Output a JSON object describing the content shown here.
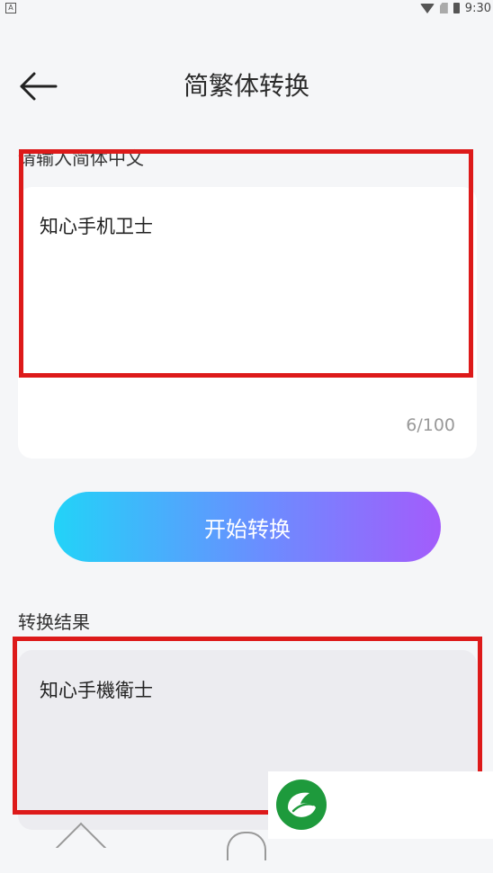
{
  "status_bar": {
    "left_indicator": "A",
    "time": "9:30",
    "icons": [
      "wifi-icon",
      "sim-icon",
      "battery-icon"
    ]
  },
  "header": {
    "title": "简繁体转换",
    "back_icon": "arrow-left-icon"
  },
  "input": {
    "label": "请输入简体中文",
    "value": "知心手机卫士",
    "counter": "6/100"
  },
  "convert_button": {
    "label": "开始转换"
  },
  "result": {
    "label": "转换结果",
    "value": "知心手機衛士"
  },
  "colors": {
    "gradient_start": "#22d3f8",
    "gradient_end": "#a35cfb",
    "highlight": "#dd1a1a",
    "logo_green": "#1e9a3c"
  }
}
